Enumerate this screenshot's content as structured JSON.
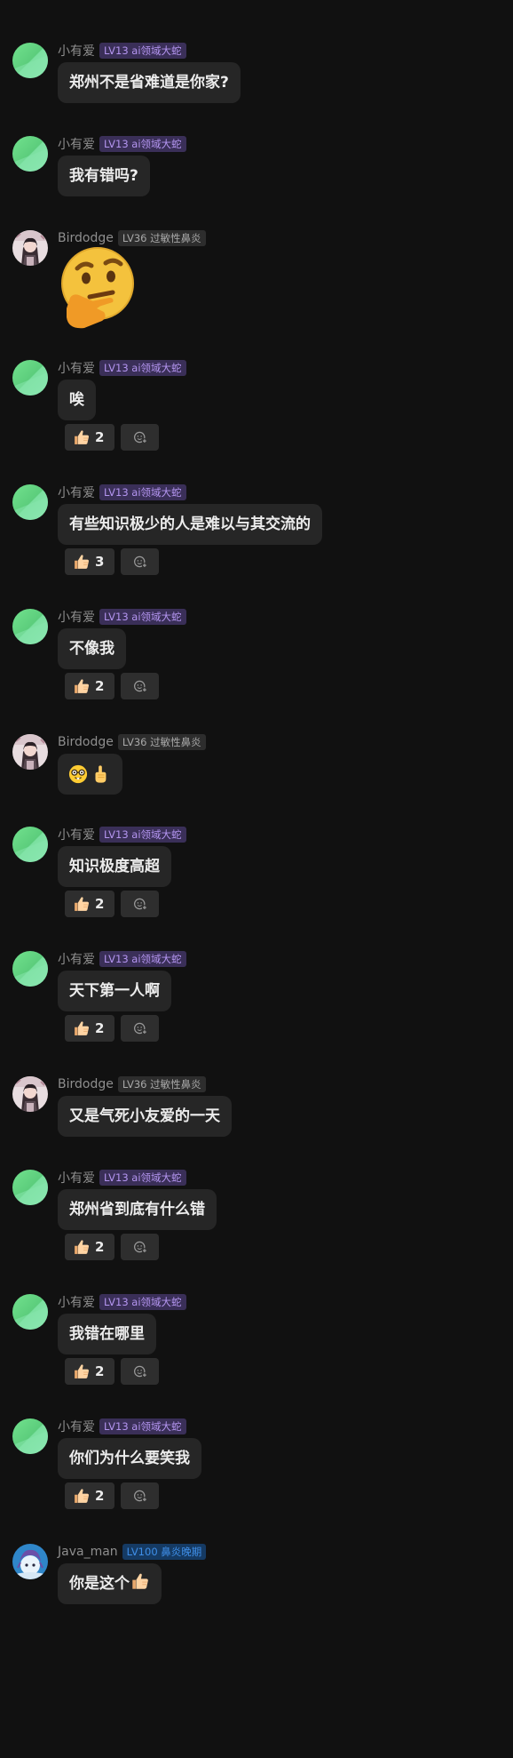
{
  "users": {
    "xiaoyouai": {
      "name": "小有爱",
      "badge": "LV13 ai领域大蛇",
      "badge_style": "purple",
      "avatar": "green-gradient-avatar"
    },
    "birdodge": {
      "name": "Birdodge",
      "badge": "LV36 过敏性鼻炎",
      "badge_style": "gray",
      "avatar": "anime-character-avatar"
    },
    "java_man": {
      "name": "Java_man",
      "badge": "LV100 鼻炎晚期",
      "badge_style": "blue",
      "avatar": "blue-anime-avatar"
    }
  },
  "messages": [
    {
      "user_name": "小有爱",
      "badge": "LV13 ai领域大蛇",
      "text": "郑州不是省难道是你家?"
    },
    {
      "user_name": "小有爱",
      "badge": "LV13 ai领域大蛇",
      "text": "我有错吗?"
    },
    {
      "user_name": "Birdodge",
      "badge": "LV36 过敏性鼻炎",
      "sticker": "thinking-face-emoji"
    },
    {
      "user_name": "小有爱",
      "badge": "LV13 ai领域大蛇",
      "text": "唉",
      "like_count": "2"
    },
    {
      "user_name": "小有爱",
      "badge": "LV13 ai领域大蛇",
      "text": "有些知识极少的人是难以与其交流的",
      "like_count": "3"
    },
    {
      "user_name": "小有爱",
      "badge": "LV13 ai领域大蛇",
      "text": "不像我",
      "like_count": "2"
    },
    {
      "user_name": "Birdodge",
      "badge": "LV36 过敏性鼻炎",
      "emojis": [
        "nerd-face-emoji",
        "pointing-up-emoji"
      ]
    },
    {
      "user_name": "小有爱",
      "badge": "LV13 ai领域大蛇",
      "text": "知识极度高超",
      "like_count": "2"
    },
    {
      "user_name": "小有爱",
      "badge": "LV13 ai领域大蛇",
      "text": "天下第一人啊",
      "like_count": "2"
    },
    {
      "user_name": "Birdodge",
      "badge": "LV36 过敏性鼻炎",
      "text": "又是气死小友爱的一天"
    },
    {
      "user_name": "小有爱",
      "badge": "LV13 ai领域大蛇",
      "text": "郑州省到底有什么错",
      "like_count": "2"
    },
    {
      "user_name": "小有爱",
      "badge": "LV13 ai领域大蛇",
      "text": "我错在哪里",
      "like_count": "2"
    },
    {
      "user_name": "小有爱",
      "badge": "LV13 ai领域大蛇",
      "text": "你们为什么要笑我",
      "like_count": "2"
    },
    {
      "user_name": "Java_man",
      "badge": "LV100 鼻炎晚期",
      "text": "你是这个",
      "trailing_emoji": "thumbs-up-emoji"
    }
  ],
  "reactions": {
    "like_icon": "thumbs-up-icon",
    "add_icon": "add-reaction-icon"
  },
  "colors": {
    "background": "#111111",
    "bubble": "#262626",
    "text": "#ececec",
    "username": "#8e8e8e",
    "badge_purple_bg": "#3a2f58",
    "badge_purple_fg": "#b495f0",
    "badge_gray_bg": "#2d2d2d",
    "badge_gray_fg": "#a8a8a8",
    "badge_blue_bg": "#153a63",
    "badge_blue_fg": "#3f8fe8",
    "reaction_bg": "#2e2e2e"
  }
}
